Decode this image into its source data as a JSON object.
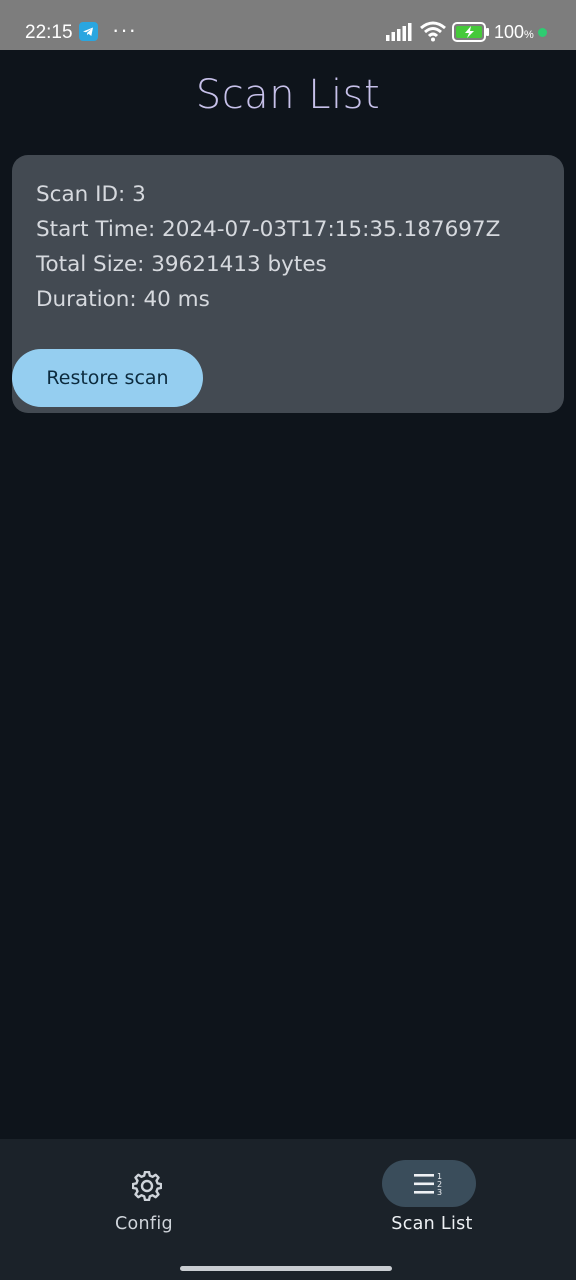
{
  "status_bar": {
    "time": "22:15",
    "more": "···",
    "battery_percent": "100",
    "battery_unit": "%",
    "icons": [
      "telegram-icon",
      "signal-icon",
      "wifi-icon",
      "battery-charging-icon"
    ]
  },
  "page": {
    "title": "Scan List"
  },
  "scan_card": {
    "scan_id": "Scan ID: 3",
    "start_time": "Start Time: 2024-07-03T17:15:35.187697Z",
    "total_size": "Total Size: 39621413 bytes",
    "duration": "Duration: 40 ms",
    "restore_label": "Restore scan"
  },
  "bottom_nav": {
    "items": [
      {
        "label": "Config",
        "icon": "gear-icon",
        "selected": false
      },
      {
        "label": "Scan List",
        "icon": "numbered-list-icon",
        "selected": true
      }
    ]
  },
  "colors": {
    "background": "#0e141b",
    "card": "#434a52",
    "button": "#95cef0",
    "title": "#c7c1ea",
    "nav_selected_pill": "#3a4d5b"
  }
}
